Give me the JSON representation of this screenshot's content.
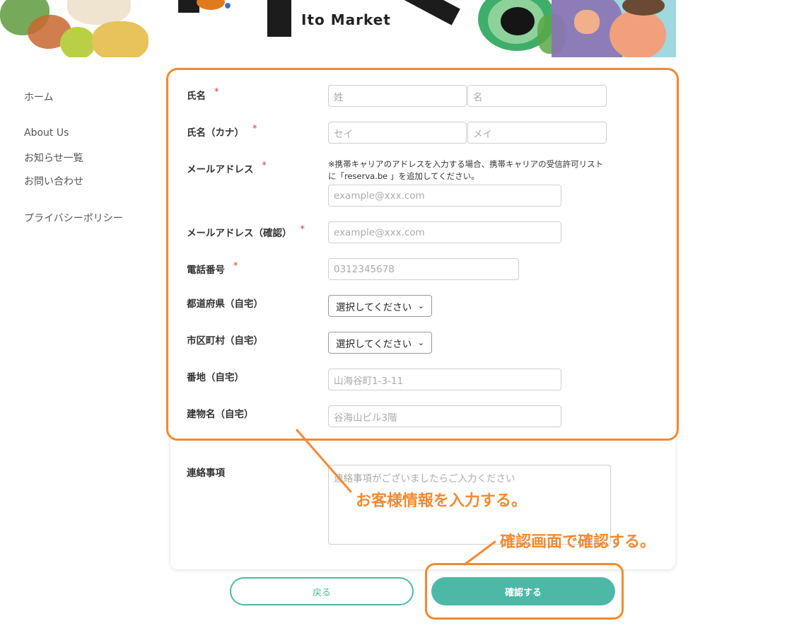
{
  "header": {
    "logo_text": "Ito Market"
  },
  "sidebar": {
    "items": [
      {
        "label": "ホーム"
      },
      {
        "label": "About Us"
      },
      {
        "label": "お知らせ一覧"
      },
      {
        "label": "お問い合わせ"
      },
      {
        "label": "プライバシーポリシー"
      }
    ]
  },
  "form": {
    "required_mark": "*",
    "name": {
      "label": "氏名",
      "last_placeholder": "姓",
      "first_placeholder": "名"
    },
    "kana": {
      "label": "氏名（カナ）",
      "last_placeholder": "セイ",
      "first_placeholder": "メイ"
    },
    "email": {
      "label": "メールアドレス",
      "note": "※携帯キャリアのアドレスを入力する場合、携帯キャリアの受信許可リストに「reserva.be 」を追加してください。",
      "placeholder": "example@xxx.com"
    },
    "email_confirm": {
      "label": "メールアドレス（確認）",
      "placeholder": "example@xxx.com"
    },
    "phone": {
      "label": "電話番号",
      "placeholder": "0312345678"
    },
    "prefecture": {
      "label": "都道府県（自宅）",
      "selected": "選択してください"
    },
    "city": {
      "label": "市区町村（自宅）",
      "selected": "選択してください"
    },
    "address": {
      "label": "番地（自宅）",
      "placeholder": "山海谷町1-3-11"
    },
    "building": {
      "label": "建物名（自宅）",
      "placeholder": "谷海山ビル3階"
    },
    "message": {
      "label": "連絡事項",
      "placeholder": "連絡事項がございましたらご入力ください"
    }
  },
  "buttons": {
    "back": "戻る",
    "confirm": "確認する"
  },
  "annotations": {
    "form_note": "お客様情報を入力する。",
    "confirm_note": "確認画面で確認する。",
    "color": "#f08a33"
  },
  "colors": {
    "accent": "#4db8a5",
    "required": "#d23a3a"
  }
}
